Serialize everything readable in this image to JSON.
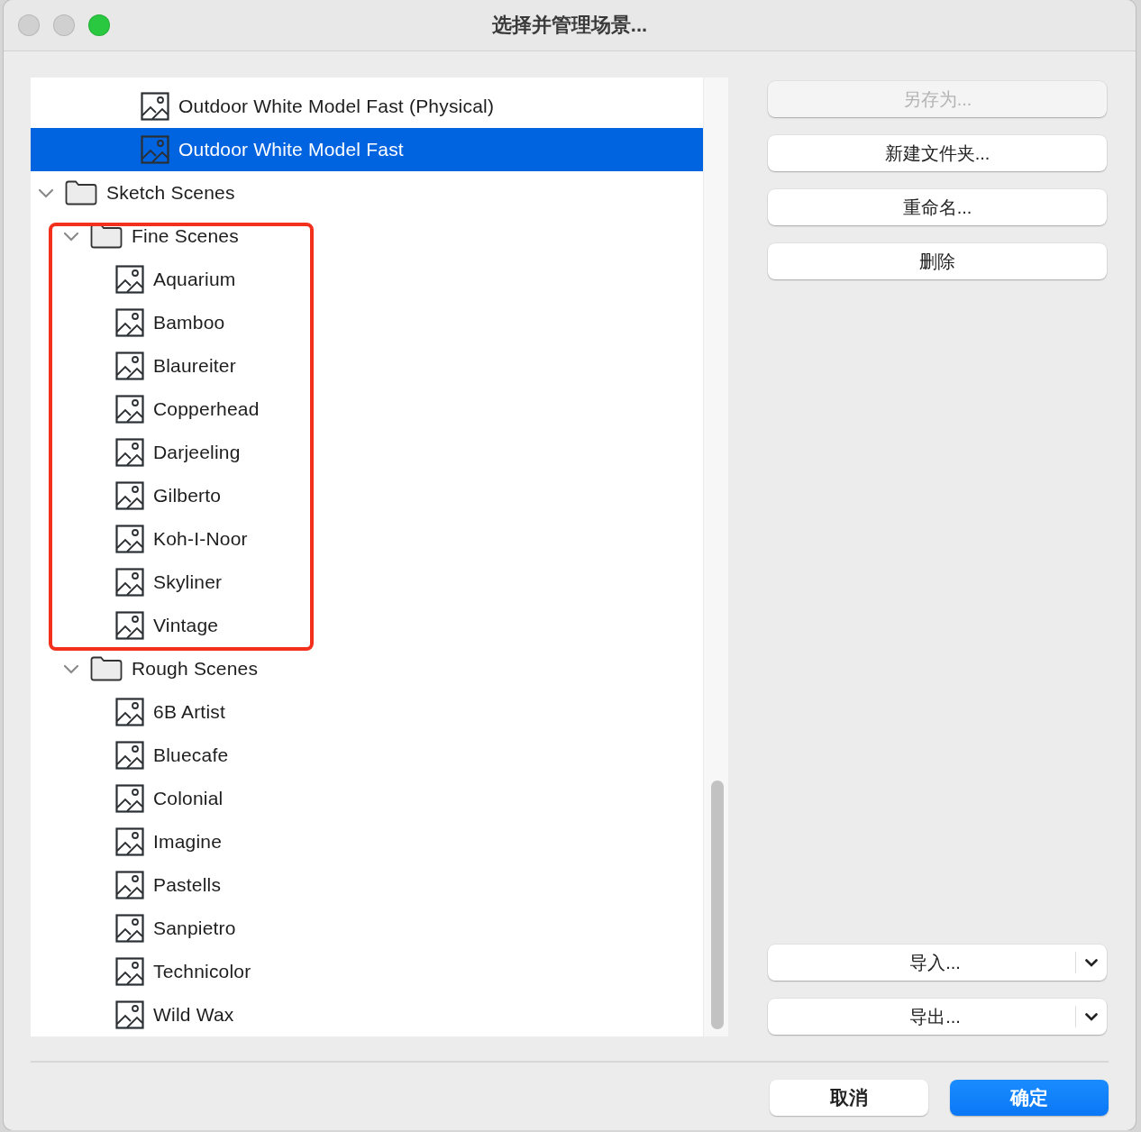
{
  "window": {
    "title": "选择并管理场景..."
  },
  "tree": [
    {
      "kind": "hidden",
      "children": [
        {
          "kind": "hidden",
          "children": [
            {
              "kind": "hidden",
              "children": [
                {
                  "kind": "scene",
                  "label": "Outdoor White Model Fast (Physical)",
                  "selected": false
                },
                {
                  "kind": "scene",
                  "label": "Outdoor White Model Fast",
                  "selected": true
                }
              ]
            }
          ]
        }
      ]
    },
    {
      "kind": "folder",
      "label": "Sketch Scenes",
      "expanded": true,
      "selected": false,
      "children": [
        {
          "kind": "folder",
          "label": "Fine Scenes",
          "expanded": true,
          "selected": false,
          "highlighted": true,
          "children": [
            {
              "kind": "scene",
              "label": "Aquarium",
              "selected": false
            },
            {
              "kind": "scene",
              "label": "Bamboo",
              "selected": false
            },
            {
              "kind": "scene",
              "label": "Blaureiter",
              "selected": false
            },
            {
              "kind": "scene",
              "label": "Copperhead",
              "selected": false
            },
            {
              "kind": "scene",
              "label": "Darjeeling",
              "selected": false
            },
            {
              "kind": "scene",
              "label": "Gilberto",
              "selected": false
            },
            {
              "kind": "scene",
              "label": "Koh-I-Noor",
              "selected": false
            },
            {
              "kind": "scene",
              "label": "Skyliner",
              "selected": false
            },
            {
              "kind": "scene",
              "label": "Vintage",
              "selected": false
            }
          ]
        },
        {
          "kind": "folder",
          "label": "Rough Scenes",
          "expanded": true,
          "selected": false,
          "children": [
            {
              "kind": "scene",
              "label": "6B Artist",
              "selected": false
            },
            {
              "kind": "scene",
              "label": "Bluecafe",
              "selected": false
            },
            {
              "kind": "scene",
              "label": "Colonial",
              "selected": false
            },
            {
              "kind": "scene",
              "label": "Imagine",
              "selected": false
            },
            {
              "kind": "scene",
              "label": "Pastells",
              "selected": false
            },
            {
              "kind": "scene",
              "label": "Sanpietro",
              "selected": false
            },
            {
              "kind": "scene",
              "label": "Technicolor",
              "selected": false
            },
            {
              "kind": "scene",
              "label": "Wild Wax",
              "selected": false
            }
          ]
        }
      ]
    }
  ],
  "side_buttons": [
    {
      "label": "另存为...",
      "disabled": true
    },
    {
      "label": "新建文件夹...",
      "disabled": false
    },
    {
      "label": "重命名...",
      "disabled": false
    },
    {
      "label": "删除",
      "disabled": false
    }
  ],
  "menu_buttons": [
    {
      "label": "导入..."
    },
    {
      "label": "导出..."
    }
  ],
  "footer_buttons": [
    {
      "label": "取消",
      "kind": "cancel"
    },
    {
      "label": "确定",
      "kind": "default"
    }
  ]
}
